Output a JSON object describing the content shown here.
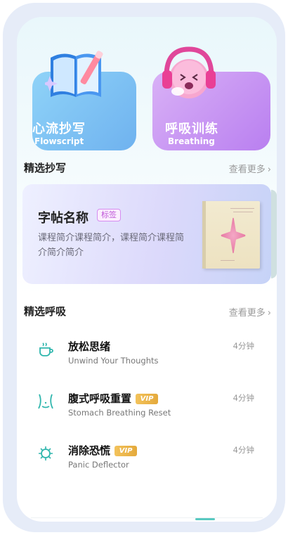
{
  "features": [
    {
      "title": "心流抄写",
      "subtitle": "Flowscript",
      "icon": "book-pencil-icon",
      "color": "#6fb2ef"
    },
    {
      "title": "呼吸训练",
      "subtitle": "Breathing",
      "icon": "headphones-mascot-icon",
      "color": "#b97ff0"
    }
  ],
  "copybook_section": {
    "title": "精选抄写",
    "more": "查看更多",
    "card": {
      "name": "字帖名称",
      "tag": "标签",
      "description": "课程简介课程简介，课程简介课程简介简介简介"
    }
  },
  "breathing_section": {
    "title": "精选呼吸",
    "more": "查看更多",
    "items": [
      {
        "title": "放松思绪",
        "subtitle": "Unwind Your Thoughts",
        "duration": "4分钟",
        "vip": false,
        "vip_label": "",
        "icon": "tea-cup-icon"
      },
      {
        "title": "腹式呼吸重置",
        "subtitle": "Stomach Breathing Reset",
        "duration": "4分钟",
        "vip": true,
        "vip_label": "VIP",
        "icon": "stomach-icon"
      },
      {
        "title": "消除恐慌",
        "subtitle": "Panic Deflector",
        "duration": "4分钟",
        "vip": true,
        "vip_label": "VIP",
        "icon": "virus-icon"
      }
    ]
  },
  "colors": {
    "accent": "#59c9c1",
    "vip": "#e4a93b",
    "tag": "#c05ad8"
  }
}
